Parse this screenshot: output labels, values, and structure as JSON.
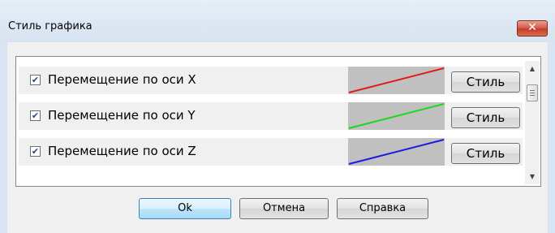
{
  "window": {
    "title": "Стиль графика",
    "close_icon": "close-icon",
    "close_glyph": "✕"
  },
  "colors": {
    "x_line": "#e21a1a",
    "y_line": "#1ad81a",
    "z_line": "#1a1ae0"
  },
  "rows": [
    {
      "checked": true,
      "check_glyph": "✔",
      "label": "Перемещение по оси X",
      "style_label": "Стиль"
    },
    {
      "checked": true,
      "check_glyph": "✔",
      "label": "Перемещение по оси Y",
      "style_label": "Стиль"
    },
    {
      "checked": true,
      "check_glyph": "✔",
      "label": "Перемещение по оси Z",
      "style_label": "Стиль"
    }
  ],
  "scrollbar": {
    "up_glyph": "▲",
    "down_glyph": "▼"
  },
  "buttons": {
    "ok": "Ok",
    "cancel": "Отмена",
    "help": "Справка"
  }
}
